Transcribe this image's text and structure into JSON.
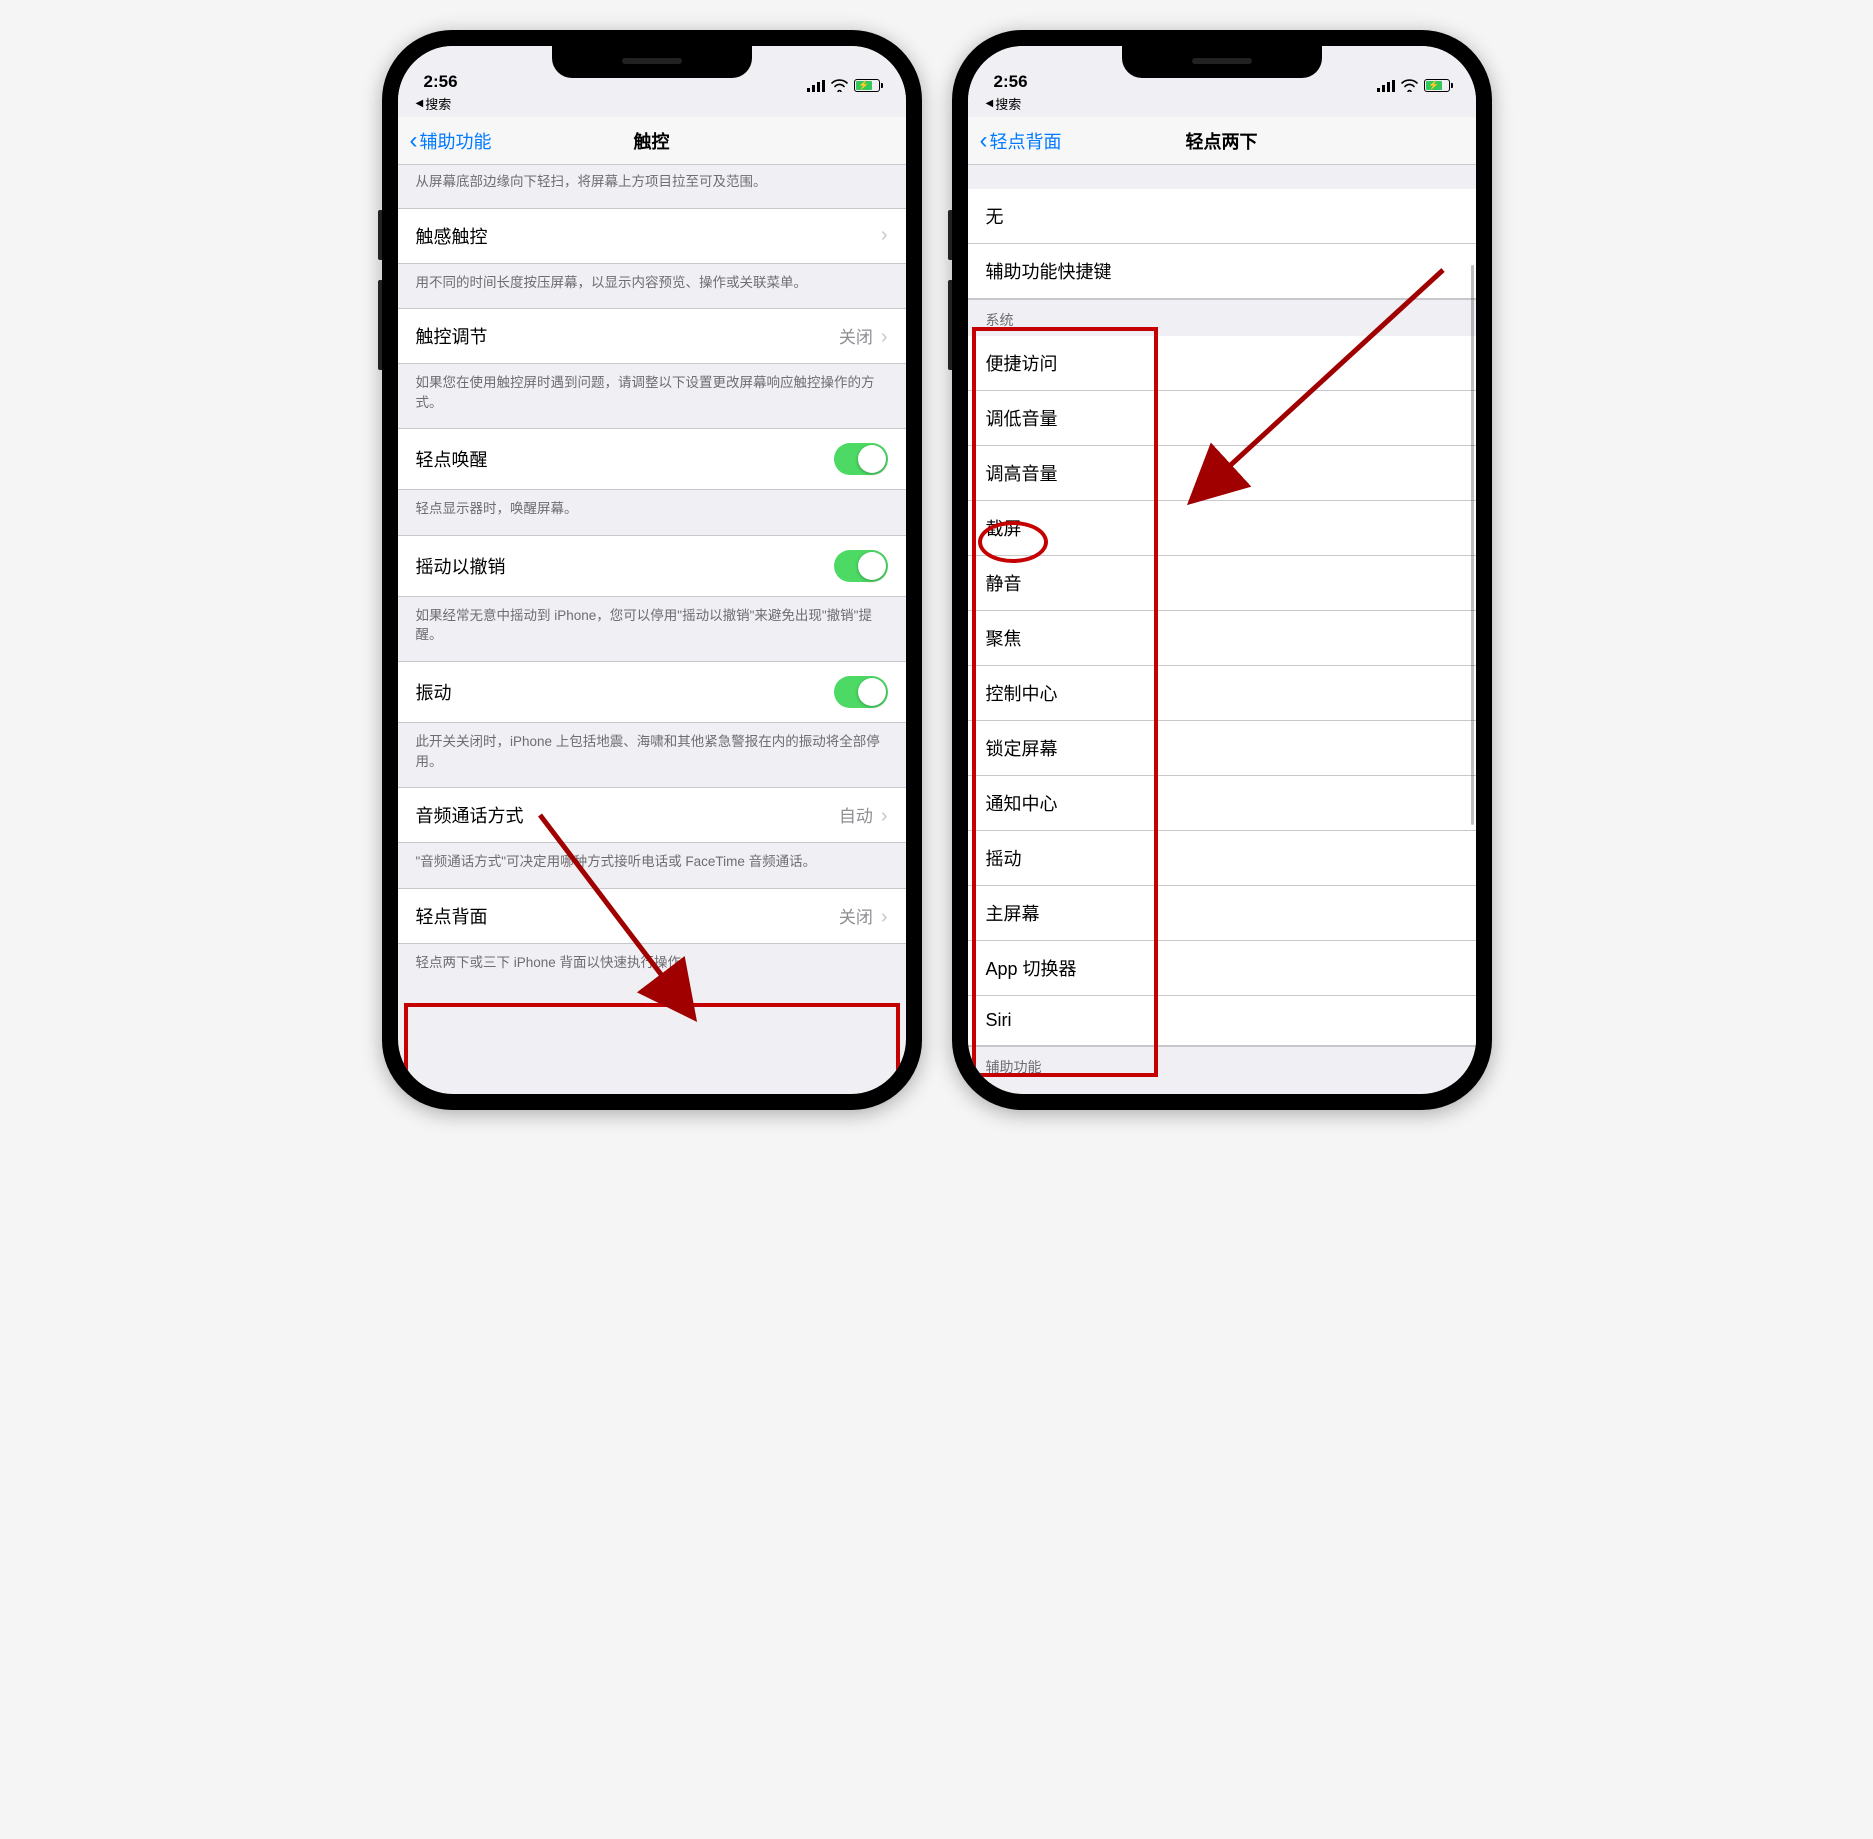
{
  "status": {
    "time": "2:56",
    "breadcrumb_icon": "◀",
    "breadcrumb": "搜索"
  },
  "left": {
    "nav_back": "辅助功能",
    "nav_title": "触控",
    "intro_footer": "从屏幕底部边缘向下轻扫，将屏幕上方项目拉至可及范围。",
    "items": [
      {
        "label": "触感触控",
        "footer": "用不同的时间长度按压屏幕，以显示内容预览、操作或关联菜单。"
      },
      {
        "label": "触控调节",
        "value": "关闭",
        "footer": "如果您在使用触控屏时遇到问题，请调整以下设置更改屏幕响应触控操作的方式。"
      },
      {
        "label": "轻点唤醒",
        "toggle": true,
        "footer": "轻点显示器时，唤醒屏幕。"
      },
      {
        "label": "摇动以撤销",
        "toggle": true,
        "footer": "如果经常无意中摇动到 iPhone，您可以停用\"摇动以撤销\"来避免出现\"撤销\"提醒。"
      },
      {
        "label": "振动",
        "toggle": true,
        "footer": "此开关关闭时，iPhone 上包括地震、海啸和其他紧急警报在内的振动将全部停用。"
      },
      {
        "label": "音频通话方式",
        "value": "自动",
        "footer": "\"音频通话方式\"可决定用哪种方式接听电话或 FaceTime 音频通话。"
      },
      {
        "label": "轻点背面",
        "value": "关闭",
        "footer": "轻点两下或三下 iPhone 背面以快速执行操作。"
      }
    ]
  },
  "right": {
    "nav_back": "轻点背面",
    "nav_title": "轻点两下",
    "top_items": [
      "无",
      "辅助功能快捷键"
    ],
    "section_header": "系统",
    "system_items": [
      "便捷访问",
      "调低音量",
      "调高音量",
      "截屏",
      "静音",
      "聚焦",
      "控制中心",
      "锁定屏幕",
      "通知中心",
      "摇动",
      "主屏幕",
      "App 切换器",
      "Siri"
    ],
    "bottom_section_header": "辅助功能",
    "highlighted_item": "截屏"
  }
}
